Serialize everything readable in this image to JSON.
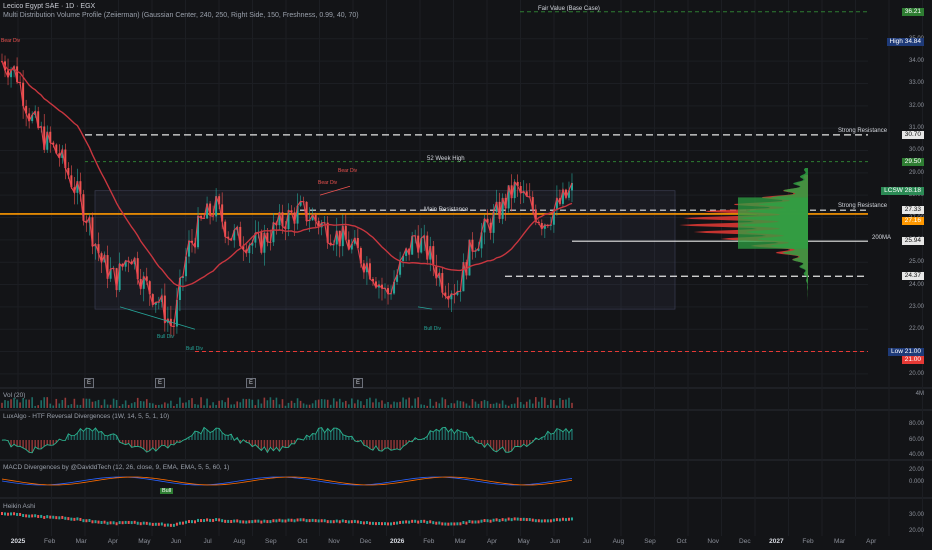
{
  "header": {
    "symbol_line": "Lecico Egypt SAE · 1D · EGX",
    "indicator_line": "Multi Distribution Volume Profile (Zeiierman) (Gaussian Center, 240, 250, Right Side, 150, Freshness, 0.99, 40, 70)"
  },
  "price_axis": {
    "labels": [
      "35.00",
      "34.00",
      "33.00",
      "32.00",
      "31.00",
      "30.00",
      "29.00",
      "28.00",
      "27.00",
      "26.00",
      "25.00",
      "24.00",
      "23.00",
      "22.00",
      "21.00",
      "20.00"
    ],
    "tags": [
      {
        "name": "fair-value-tag",
        "label": "",
        "value": "36.21",
        "color": "#2e7d32"
      },
      {
        "name": "high-tag",
        "label": "High",
        "value": "34.84",
        "color": "#1e3a78"
      },
      {
        "name": "strong-resistance-tag",
        "label": "",
        "value": "30.70",
        "color": "#e6e6e6"
      },
      {
        "name": "week-high-tag",
        "label": "",
        "value": "29.50",
        "color": "#2e7d32"
      },
      {
        "name": "lcsw-tag",
        "label": "LCSW",
        "value": "28.18",
        "color": "#2b8a55"
      },
      {
        "name": "resistance-tag",
        "label": "",
        "value": "27.33",
        "color": "#e6e6e6"
      },
      {
        "name": "ma-tag",
        "label": "",
        "value": "27.16",
        "color": "#ff9800"
      },
      {
        "name": "ma200-tag",
        "label": "",
        "value": "25.94",
        "color": "#e6e6e6"
      },
      {
        "name": "support-tag",
        "label": "",
        "value": "24.37",
        "color": "#e6e6e6"
      },
      {
        "name": "low-tag",
        "label": "Low",
        "value": "21.00",
        "color": "#1e3a78"
      },
      {
        "name": "low-red-tag",
        "label": "",
        "value": "21.00",
        "color": "#e53935"
      }
    ]
  },
  "annotations": {
    "fair_value": "Fair Value (Base Case)",
    "strong_resistance_top": "Strong Resistance",
    "week_high": "52 Week High",
    "strong_resistance": "Strong Resistance",
    "main_resistance": "Main Resistance",
    "ma200": "200MA",
    "bear_div_1": "Bear Div",
    "bear_div_2": "Bear Div",
    "bear_div_3": "Bear Div",
    "bull_div_1": "Bull Div",
    "bull_div_2": "Bull Div",
    "bull_div_3": "Bull Div",
    "earnings_marker": "E"
  },
  "panes": {
    "vol": {
      "title": "Vol (20)",
      "axis": [
        "4M"
      ]
    },
    "luxalgo": {
      "title": "LuxAlgo - HTF Reversal Divergences (1W, 14, 5, 5, 1, 10)",
      "axis": [
        "80.00",
        "60.00",
        "40.00",
        "20.00"
      ]
    },
    "macd": {
      "title": "MACD Divergences by @DaviddTech (12, 26, close, 9, EMA, EMA, 5, 5, 60, 1)",
      "axis": [
        "0.000"
      ],
      "badge": "Bull"
    },
    "heikin": {
      "title": "Heikin Ashi",
      "axis": [
        "30.00",
        "20.00"
      ]
    }
  },
  "time_axis": [
    "2025",
    "Feb",
    "Mar",
    "Apr",
    "May",
    "Jun",
    "Jul",
    "Aug",
    "Sep",
    "Oct",
    "Nov",
    "Dec",
    "2026",
    "Feb",
    "Mar",
    "Apr",
    "May",
    "Jun",
    "Jul",
    "Aug",
    "Sep",
    "Oct",
    "Nov",
    "Dec",
    "2027",
    "Feb",
    "Mar",
    "Apr"
  ],
  "colors": {
    "background": "#131417",
    "bull": "#26a69a",
    "bear": "#ef5350",
    "ma_red": "#e2424f",
    "orange": "#ff9800",
    "green_dash": "#2e7d32",
    "red_dash": "#e53935"
  },
  "chart_data": {
    "type": "candlestick",
    "price_range": [
      19.5,
      37.0
    ],
    "series_close_approx": [
      34.0,
      33.5,
      31.5,
      30.5,
      29.8,
      28.5,
      27.0,
      25.0,
      24.2,
      25.5,
      24.0,
      23.3,
      22.0,
      25.5,
      26.8,
      27.5,
      26.2,
      26.0,
      25.8,
      26.4,
      27.0,
      27.3,
      26.9,
      26.4,
      26.0,
      25.4,
      24.6,
      23.5,
      24.8,
      26.2,
      25.3,
      24.0,
      23.8,
      25.8,
      26.5,
      27.4,
      28.3,
      27.6,
      26.8,
      27.5,
      28.2
    ],
    "levels": {
      "fair_value": 36.21,
      "high": 34.84,
      "strong_resistance_top": 30.7,
      "week_52_high": 29.5,
      "last": 28.18,
      "resistance": 27.33,
      "ma": 27.16,
      "ma200": 25.94,
      "support": 24.37,
      "low": 21.0
    }
  }
}
